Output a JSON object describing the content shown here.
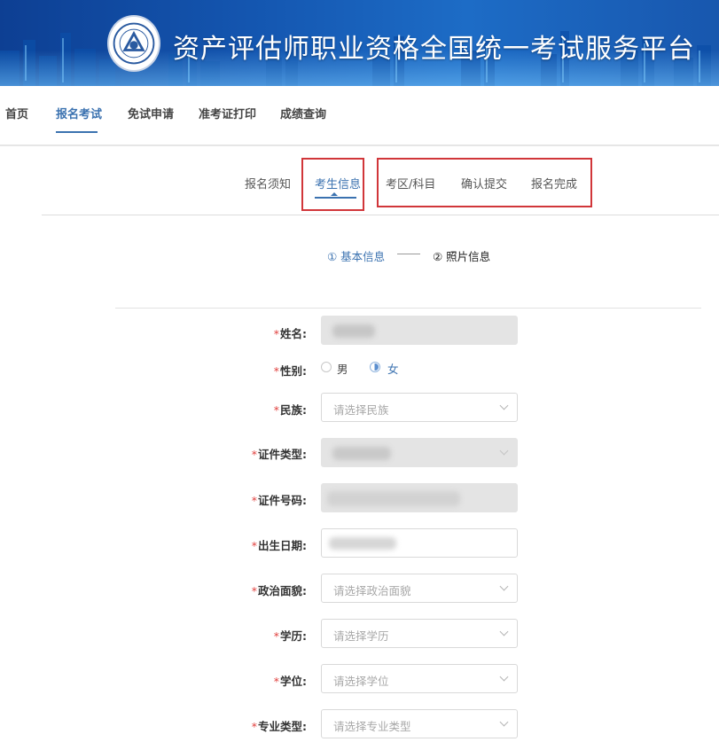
{
  "banner": {
    "title": "资产评估师职业资格全国统一考试服务平台"
  },
  "nav": {
    "items": [
      "首页",
      "报名考试",
      "免试申请",
      "准考证打印",
      "成绩查询"
    ]
  },
  "step_tabs": [
    "报名须知",
    "考生信息",
    "考区/科目",
    "确认提交",
    "报名完成"
  ],
  "sub_steps": {
    "step1": "① 基本信息",
    "step2": "② 照片信息"
  },
  "form": {
    "name": {
      "label": "姓名:"
    },
    "gender": {
      "label": "性别:",
      "options": [
        "男",
        "女"
      ],
      "selected": "女"
    },
    "ethnicity": {
      "label": "民族:",
      "placeholder": "请选择民族"
    },
    "id_type": {
      "label": "证件类型:"
    },
    "id_number": {
      "label": "证件号码:"
    },
    "birth_date": {
      "label": "出生日期:"
    },
    "political_status": {
      "label": "政治面貌:",
      "placeholder": "请选择政治面貌"
    },
    "education": {
      "label": "学历:",
      "placeholder": "请选择学历"
    },
    "degree": {
      "label": "学位:",
      "placeholder": "请选择学位"
    },
    "major_type": {
      "label": "专业类型:",
      "placeholder": "请选择专业类型"
    }
  },
  "colors": {
    "accent": "#3b72b0",
    "required": "#e0403e",
    "highlight_box": "#d1363a"
  }
}
